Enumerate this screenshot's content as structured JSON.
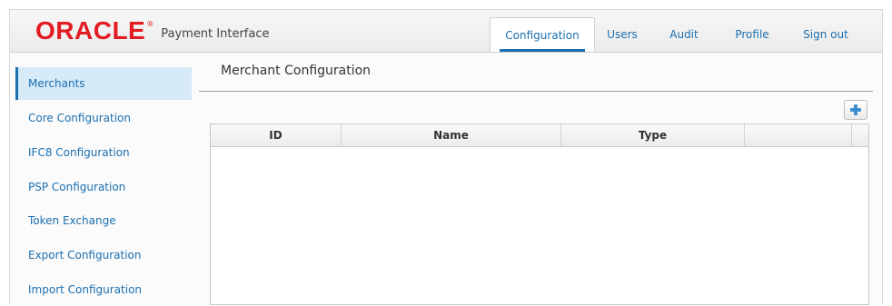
{
  "app": {
    "brand": "ORACLE",
    "brand_mark": "®",
    "product": "Payment Interface"
  },
  "nav": {
    "items": [
      {
        "label": "Configuration",
        "active": true
      },
      {
        "label": "Users",
        "active": false
      },
      {
        "label": "Audit",
        "active": false
      },
      {
        "label": "Profile",
        "active": false
      },
      {
        "label": "Sign out",
        "active": false
      }
    ]
  },
  "sidebar": {
    "items": [
      {
        "label": "Merchants",
        "active": true
      },
      {
        "label": "Core Configuration",
        "active": false
      },
      {
        "label": "IFC8 Configuration",
        "active": false
      },
      {
        "label": "PSP Configuration",
        "active": false
      },
      {
        "label": "Token Exchange",
        "active": false
      },
      {
        "label": "Export Configuration",
        "active": false
      },
      {
        "label": "Import Configuration",
        "active": false
      }
    ]
  },
  "main": {
    "title": "Merchant Configuration",
    "add_button_icon": "plus-icon",
    "table": {
      "columns": [
        "ID",
        "Name",
        "Type",
        ""
      ],
      "rows": []
    }
  },
  "colors": {
    "brand_red": "#e31b23",
    "link_blue": "#1b6fb0",
    "active_bg": "#d6eaf8",
    "add_icon": "#3d8ed0"
  }
}
